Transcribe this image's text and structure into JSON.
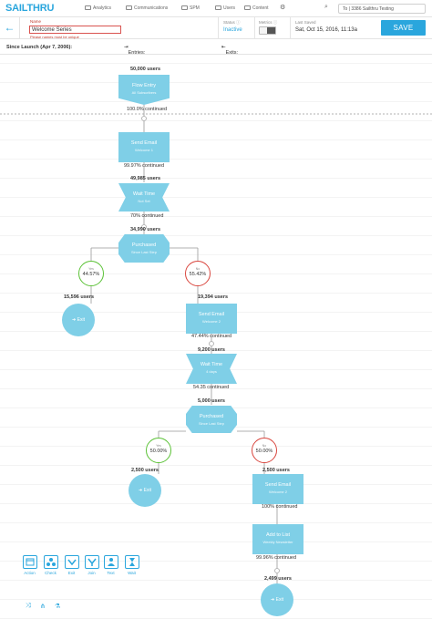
{
  "nav": {
    "logo": "SAILTHRU",
    "items": [
      "Analytics",
      "Communications",
      "SPM",
      "Users",
      "Content"
    ],
    "account": "3386 Sailthru Testing",
    "account_prefix": "To"
  },
  "header": {
    "back_icon": "arrow-left-icon",
    "name_label": "Name",
    "name_value": "Welcome Series",
    "name_error": "Please names must be unique",
    "status_label": "Status",
    "status_value": "Inactive",
    "metrics_label": "Metrics",
    "last_saved_label": "Last Saved",
    "last_saved_value": "Sat, Oct 15, 2016, 11:13a",
    "save_label": "SAVE",
    "accent": "#2aa6dd"
  },
  "stats": {
    "since_launch": "Since Launch (Apr 7, 2006):",
    "entries": "Entries: 50,000 users",
    "exits": "Exits: 50,400 users"
  },
  "flow": {
    "entry": {
      "title": "Flow Entry",
      "sub": "All Subscribers",
      "count": "50,000 users",
      "continued": "100.0% continued"
    },
    "email1": {
      "title": "Send Email",
      "sub": "Welcome 1",
      "continued": "99.97% continued"
    },
    "wait1": {
      "count": "49,985 users",
      "title": "Wait Time",
      "sub": "Not Set",
      "continued": "70% continued"
    },
    "purchased1": {
      "count": "34,990 users",
      "title": "Purchased",
      "sub": "Since Last Step"
    },
    "branch1_yes": {
      "label": "Yes",
      "pct": "44.57%",
      "count": "15,596 users"
    },
    "branch1_no": {
      "label": "No",
      "pct": "55.42%",
      "count": "19,394 users"
    },
    "exit1": {
      "label": "Exit"
    },
    "email2": {
      "title": "Send Email",
      "sub": "Welcome 2",
      "continued": "47.44% continued"
    },
    "wait2": {
      "count": "9,200 users",
      "title": "Wait Time",
      "sub": "4 days",
      "continued": "54.35 continued"
    },
    "purchased2": {
      "count": "5,000 users",
      "title": "Purchased",
      "sub": "Since Last Step"
    },
    "branch2_yes": {
      "label": "Yes",
      "pct": "50.00%",
      "count": "2,500 users"
    },
    "branch2_no": {
      "label": "No",
      "pct": "50.00%",
      "count": "2,500 users"
    },
    "exit2": {
      "label": "Exit"
    },
    "email3": {
      "title": "Send Email",
      "sub": "Welcome 2",
      "continued": "100% continued"
    },
    "addlist": {
      "title": "Add to List",
      "sub": "Weekly Newsletter",
      "continued": "99.96% continued"
    },
    "exit3": {
      "count": "2,499 users",
      "label": "Exit"
    }
  },
  "toolbox": {
    "items": [
      "Action",
      "Check",
      "Exit",
      "Join",
      "Text",
      "Wait"
    ],
    "bottom_icons": [
      "shuffle-icon",
      "flow-icon",
      "flask-icon"
    ]
  },
  "colors": {
    "node": "#7fcfe7",
    "yes": "#5bc236",
    "no": "#d9463e",
    "line": "#888888"
  }
}
